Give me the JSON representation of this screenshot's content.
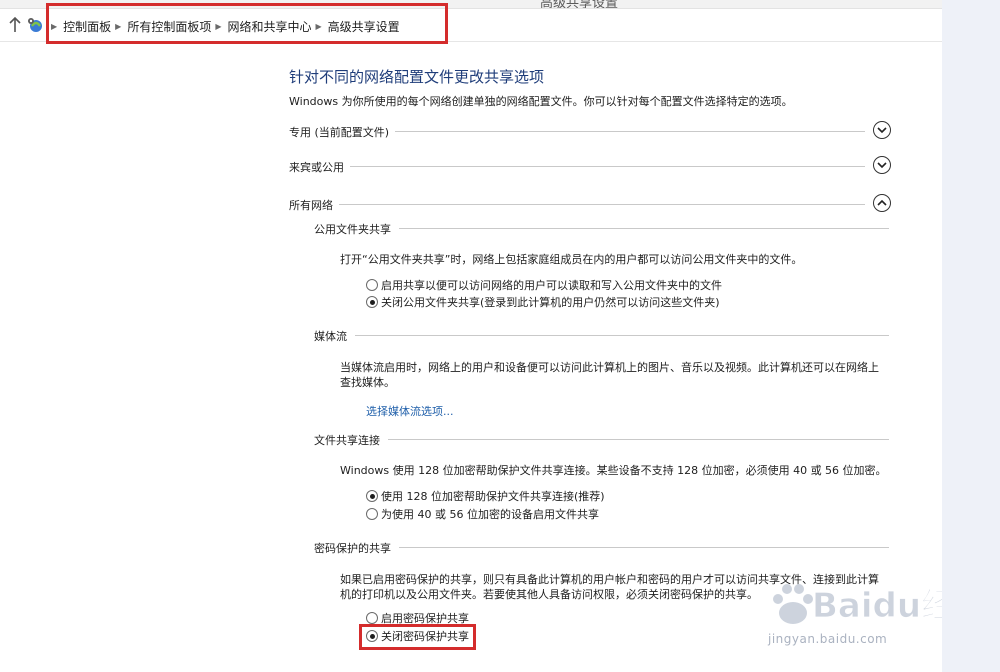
{
  "window": {
    "title": "高级共享设置"
  },
  "address_bar": {
    "breadcrumbs": [
      "控制面板",
      "所有控制面板项",
      "网络和共享中心",
      "高级共享设置"
    ]
  },
  "page": {
    "heading": "针对不同的网络配置文件更改共享选项",
    "description": "Windows 为你所使用的每个网络创建单独的网络配置文件。你可以针对每个配置文件选择特定的选项。"
  },
  "profiles": [
    {
      "label": "专用 (当前配置文件)",
      "state": "collapsed",
      "icon": "chevron-down-icon"
    },
    {
      "label": "来宾或公用",
      "state": "collapsed",
      "icon": "chevron-down-icon"
    },
    {
      "label": "所有网络",
      "state": "expanded",
      "icon": "chevron-up-icon"
    }
  ],
  "all_networks": {
    "public_folder": {
      "title": "公用文件夹共享",
      "description": "打开“公用文件夹共享”时，网络上包括家庭组成员在内的用户都可以访问公用文件夹中的文件。",
      "options": [
        {
          "label": "启用共享以便可以访问网络的用户可以读取和写入公用文件夹中的文件",
          "checked": false
        },
        {
          "label": "关闭公用文件夹共享(登录到此计算机的用户仍然可以访问这些文件夹)",
          "checked": true
        }
      ]
    },
    "media_streaming": {
      "title": "媒体流",
      "description_line1": "当媒体流启用时，网络上的用户和设备便可以访问此计算机上的图片、音乐以及视频。此计算机还可以在网络上",
      "description_line2": "查找媒体。",
      "link": "选择媒体流选项..."
    },
    "file_sharing": {
      "title": "文件共享连接",
      "description": "Windows 使用 128 位加密帮助保护文件共享连接。某些设备不支持 128 位加密，必须使用 40 或 56 位加密。",
      "options": [
        {
          "label": "使用 128 位加密帮助保护文件共享连接(推荐)",
          "checked": true
        },
        {
          "label": "为使用 40 或 56 位加密的设备启用文件共享",
          "checked": false
        }
      ]
    },
    "password_sharing": {
      "title": "密码保护的共享",
      "description_line1": "如果已启用密码保护的共享，则只有具备此计算机的用户帐户和密码的用户才可以访问共享文件、连接到此计算",
      "description_line2": "机的打印机以及公用文件夹。若要使其他人具备访问权限，必须关闭密码保护的共享。",
      "options": [
        {
          "label": "启用密码保护共享",
          "checked": false
        },
        {
          "label": "关闭密码保护共享",
          "checked": true
        }
      ]
    }
  },
  "watermark": {
    "text": "Baidu经验",
    "url": "jingyan.baidu.com"
  },
  "colors": {
    "highlight_box": "#d42c2c",
    "heading": "#1f3d7a",
    "link": "#1f5faa",
    "divider": "#c9c9c9"
  }
}
